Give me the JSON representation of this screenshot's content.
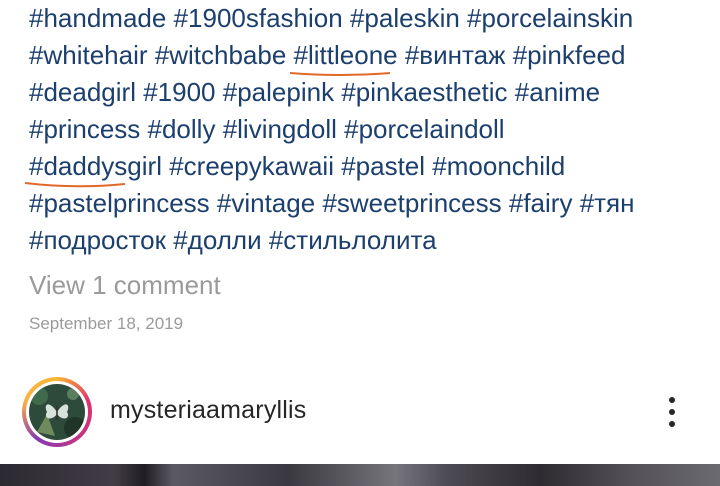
{
  "caption": {
    "lines": [
      [
        "#handmade",
        "#1900sfashion",
        "#paleskin",
        "#porcelainskin"
      ],
      [
        "#whitehair",
        "#witchbabe",
        "#littleone",
        "#винтаж",
        "#pinkfeed"
      ],
      [
        "#deadgirl",
        "#1900",
        "#palepink",
        "#pinkaesthetic",
        "#anime"
      ],
      [
        "#princess",
        "#dolly",
        "#livingdoll",
        "#porcelaindoll"
      ],
      [
        "#daddysgirl",
        "#creepykawaii",
        "#pastel",
        "#moonchild"
      ],
      [
        "#pastelprincess",
        "#vintage",
        "#sweetprincess",
        "#fairy",
        "#тян"
      ],
      [
        "#подросток",
        "#долли",
        "#стильлолита"
      ]
    ],
    "underlined_tags": [
      "#littleone",
      "#daddysgirl"
    ],
    "tag_color": "#1c3f6e",
    "underline_color": "#e0682a"
  },
  "view_comments": "View 1 comment",
  "timestamp": "September 18, 2019",
  "next_post": {
    "username": "mysteriaamaryllis",
    "avatar": "butterfly-avatar",
    "more_icon": "more-options-icon"
  }
}
